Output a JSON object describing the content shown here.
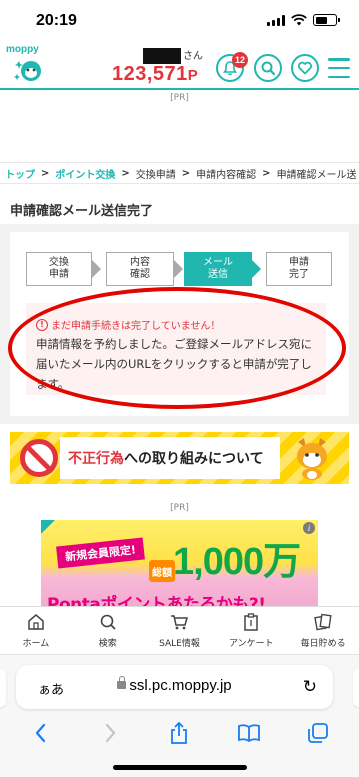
{
  "status_bar": {
    "time": "20:19"
  },
  "header": {
    "logo": "moppy",
    "name_suffix": "さん",
    "points": "123,571",
    "points_unit": "P",
    "notification_count": "12"
  },
  "pr_label": "[PR]",
  "breadcrumb": [
    "トップ",
    "ポイント交換",
    "交換申請",
    "申請内容確認",
    "申請確認メール送"
  ],
  "page_title": "申請確認メール送信完了",
  "steps": [
    {
      "line1": "交換",
      "line2": "申請"
    },
    {
      "line1": "内容",
      "line2": "確認"
    },
    {
      "line1": "メール",
      "line2": "送信"
    },
    {
      "line1": "申請",
      "line2": "完了"
    }
  ],
  "notice": {
    "warning": "まだ申請手続きは完了していません！",
    "body": "申請情報を予約しました。ご登録メールアドレス宛に届いたメール内のURLをクリックすると申請が完了します。"
  },
  "banner": {
    "red_text": "不正行為",
    "rest_text": "への取り組みについて"
  },
  "ad": {
    "ribbon": "新規会員限定!",
    "total_label": "総額",
    "amount": "1,000万",
    "bottom": "Pontaポイントあたるかも?!"
  },
  "bottom_nav": [
    {
      "label": "ホーム",
      "icon": "home-icon"
    },
    {
      "label": "検索",
      "icon": "search-icon"
    },
    {
      "label": "SALE情報",
      "icon": "cart-icon"
    },
    {
      "label": "アンケート",
      "icon": "clipboard-icon"
    },
    {
      "label": "毎日貯める",
      "icon": "cards-icon"
    }
  ],
  "safari": {
    "aa": "ぁあ",
    "url": "ssl.pc.moppy.jp"
  },
  "colors": {
    "accent": "#1fb7b0",
    "points": "#e3343b",
    "highlight_ellipse": "#e10600"
  }
}
